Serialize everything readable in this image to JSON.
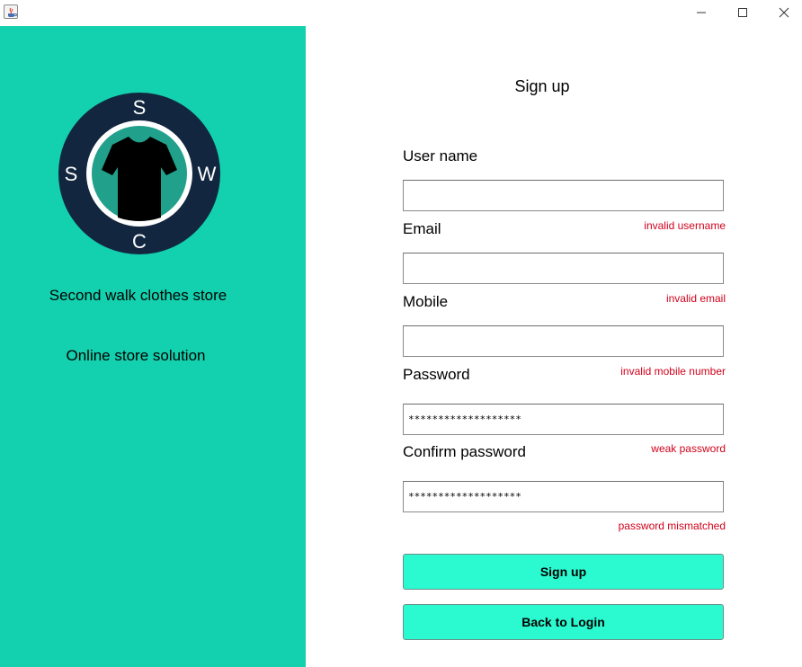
{
  "window": {
    "app_icon": "java-coffee-cup-icon",
    "controls": [
      "minimize-icon",
      "maximize-icon",
      "close-icon"
    ]
  },
  "brand": {
    "logo_letters": {
      "top": "S",
      "left": "S",
      "right": "W",
      "bottom": "C"
    },
    "logo_icon": "shirt-icon",
    "store_name": "Second walk clothes store",
    "tagline": "Online store solution",
    "colors": {
      "panel": "#13d1ae",
      "logo_ring": "#12273f",
      "logo_inner": "#21a08c",
      "button": "#2bfad0",
      "error": "#d0021b"
    }
  },
  "form": {
    "title": "Sign up",
    "username": {
      "label": "User name",
      "value": "",
      "error": "invalid username"
    },
    "email": {
      "label": "Email",
      "value": "",
      "error": "invalid email"
    },
    "mobile": {
      "label": "Mobile",
      "value": "",
      "error": "invalid mobile number"
    },
    "password": {
      "label": "Password",
      "value": "*******************",
      "error": "weak password"
    },
    "confirm_password": {
      "label": "Confirm password",
      "value": "*******************",
      "error": "password mismatched"
    },
    "signup_button": "Sign up",
    "back_button": "Back to Login"
  }
}
